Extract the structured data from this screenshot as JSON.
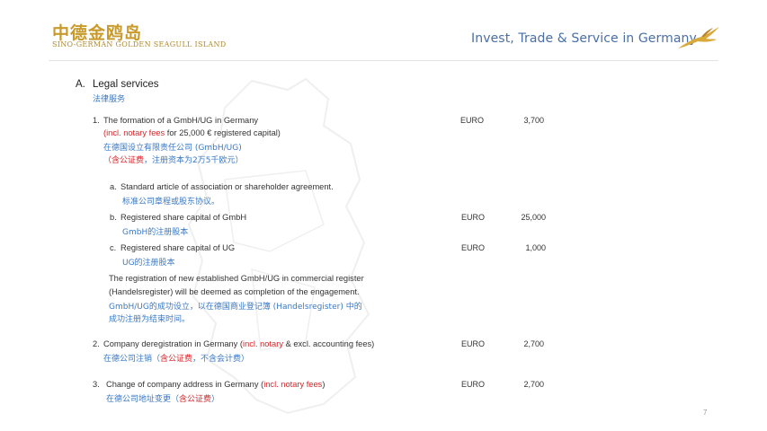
{
  "header": {
    "logo_cn": "中德金鸥岛",
    "logo_en": "SINO-GERMAN GOLDEN SEAGULL ISLAND",
    "tagline": "Invest, Trade & Service in Germany",
    "logo_icon": "seagull-icon"
  },
  "section": {
    "marker": "A.",
    "title": "Legal services",
    "title_cn": "法律服务"
  },
  "items": {
    "item1": {
      "num": "1.",
      "title": "The formation of a GmbH/UG in Germany",
      "note_red": "(incl. notary fees",
      "note_rest": " for 25,000 € registered capital)",
      "cn1": "在德国设立有限责任公司 (GmbH/UG)",
      "cn2_red": "（含公证费",
      "cn2_rest": "，注册资本为2万5千欧元）",
      "currency": "EURO",
      "amount": "3,700",
      "subs": {
        "a": {
          "num": "a.",
          "title": "Standard article of association or shareholder agreement.",
          "cn": "标准公司章程或股东协议。"
        },
        "b": {
          "num": "b.",
          "title": "Registered share capital of GmbH",
          "cn": "GmbH的注册股本",
          "currency": "EURO",
          "amount": "25,000"
        },
        "c": {
          "num": "c.",
          "title": "Registered share capital of UG",
          "cn": "UG的注册股本",
          "currency": "EURO",
          "amount": "1,000"
        }
      },
      "reg_en1": "The registration of new established GmbH/UG in commercial register",
      "reg_en2": "(Handelsregister) will be deemed as completion of the engagement.",
      "reg_cn1": "GmbH/UG的成功设立，以在德国商业登记簿 (Handelsregister) 中的",
      "reg_cn2": "成功注册为结束时间。"
    },
    "item2": {
      "num": "2.",
      "title_a": "Company deregistration in Germany (",
      "title_red": "incl. notary",
      "title_b": " & excl. accounting fees)",
      "cn_a": "在德公司注销（",
      "cn_red": "含公证费",
      "cn_b": "，不含会计费）",
      "currency": "EURO",
      "amount": "2,700"
    },
    "item3": {
      "num": "3.",
      "title_a": "Change of company address in Germany (",
      "title_red": "incl. notary fees",
      "title_b": ")",
      "cn_a": "在德公司地址变更（",
      "cn_red": "含公证费",
      "cn_b": "）",
      "currency": "EURO",
      "amount": "2,700"
    }
  },
  "page_number": "7",
  "colors": {
    "gold": "#c89a2c",
    "blue": "#3b78c4",
    "red": "#d4272b",
    "tagline": "#4a6fa5"
  }
}
